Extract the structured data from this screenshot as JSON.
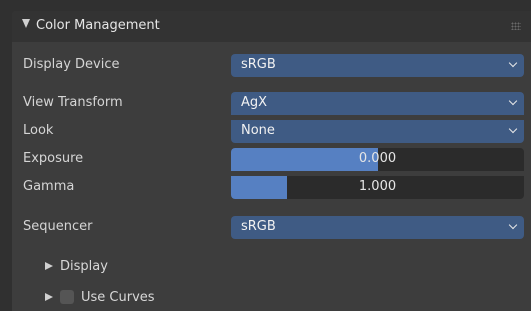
{
  "panel": {
    "title": "Color Management"
  },
  "display_device": {
    "label": "Display Device",
    "value": "sRGB"
  },
  "view_transform": {
    "label": "View Transform",
    "value": "AgX"
  },
  "look": {
    "label": "Look",
    "value": "None"
  },
  "exposure": {
    "label": "Exposure",
    "value": "0.000",
    "fill_fraction": 0.5
  },
  "gamma": {
    "label": "Gamma",
    "value": "1.000",
    "fill_fraction": 0.19
  },
  "sequencer": {
    "label": "Sequencer",
    "value": "sRGB"
  },
  "subpanels": {
    "display_label": "Display",
    "use_curves_label": "Use Curves",
    "use_curves_checked": false
  },
  "colors": {
    "dropdown_bg": "#3f5b84",
    "slider_fill": "#5680c2",
    "panel_bg": "#3d3d3d",
    "header_bg": "#333333"
  },
  "icons": {
    "panel_toggle": "disclosure-triangle-down-icon",
    "dropdown": "chevron-down-icon",
    "subpanel_toggle": "disclosure-triangle-right-icon",
    "drag": "drag-handle-icon"
  }
}
